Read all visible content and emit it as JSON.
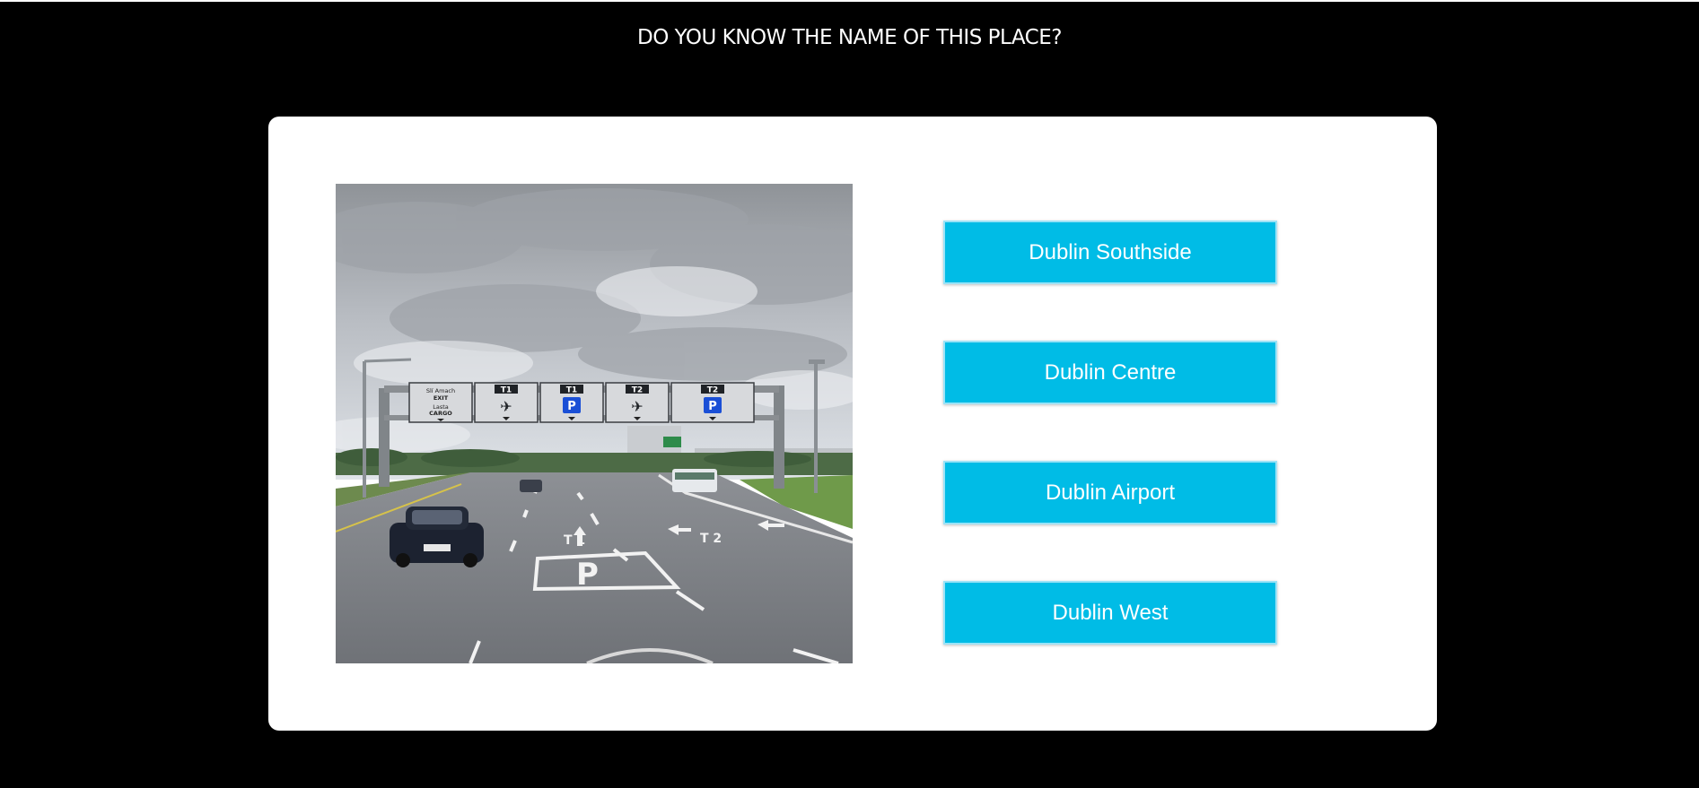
{
  "header": {
    "title": "DO YOU KNOW THE NAME OF THIS PLACE?"
  },
  "photo": {
    "description_icon": "photo-icon",
    "signs": [
      {
        "line1": "Slí Amach",
        "line2": "EXIT",
        "line3": "Lasta",
        "line4": "CARGO"
      },
      {
        "label": "T1",
        "icon": "plane-icon"
      },
      {
        "label": "T1",
        "icon": "parking-icon"
      },
      {
        "label": "T2",
        "icon": "plane-icon"
      },
      {
        "label": "T2",
        "icon": "parking-icon"
      }
    ],
    "road_markings": {
      "parking_letter": "P",
      "lane_t1": "T 1",
      "lane_t2": "T 2"
    }
  },
  "answers": [
    {
      "label": "Dublin Southside"
    },
    {
      "label": "Dublin Centre"
    },
    {
      "label": "Dublin Airport"
    },
    {
      "label": "Dublin West"
    }
  ],
  "colors": {
    "background": "#000000",
    "card": "#ffffff",
    "button": "#00bce6",
    "button_text": "#ffffff",
    "sign_blue": "#1a4fd6"
  }
}
